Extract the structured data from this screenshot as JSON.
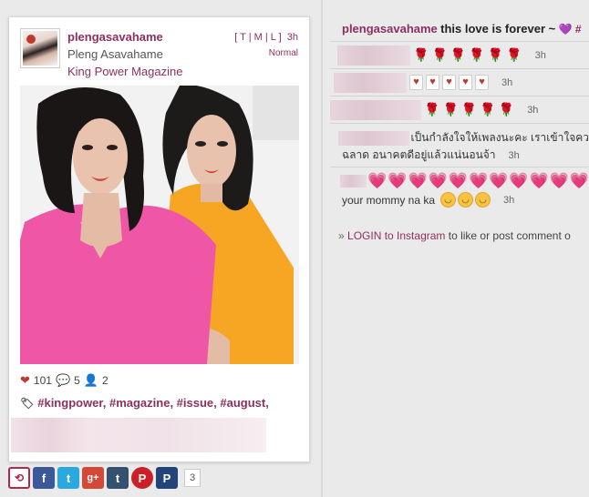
{
  "post": {
    "username": "plengasavahame",
    "full_name": "Pleng Asavahame",
    "subtitle": "King Power Magazine",
    "size_links": "[ T | M | L ]",
    "time": "3h",
    "filter": "Normal",
    "likes": "101",
    "comments_count": "5",
    "users_count": "2",
    "tags": "#kingpower, #magazine, #issue, #august,"
  },
  "share": {
    "count": "3",
    "icons": [
      "repost-icon",
      "facebook-icon",
      "twitter-icon",
      "google-plus-icon",
      "tumblr-icon",
      "pinterest-icon",
      "pinterest-alt-icon"
    ]
  },
  "comments": {
    "first": {
      "author": "plengasavahame",
      "text": "this love is forever ~",
      "more": "#"
    },
    "time": "3h",
    "thai_line1": "เป็นกำลังใจให้เพลงนะคะ เราเข้าใจคว",
    "thai_line2": "ฉลาด อนาคตดีอยู่แล้วแน่นอนจ้า",
    "mommy_text": "your mommy na ka"
  },
  "login": {
    "link": "LOGIN to Instagram",
    "rest": " to like or post comment o"
  },
  "colors": {
    "brand": "#8e2f5f",
    "background": "#eaeaea"
  }
}
